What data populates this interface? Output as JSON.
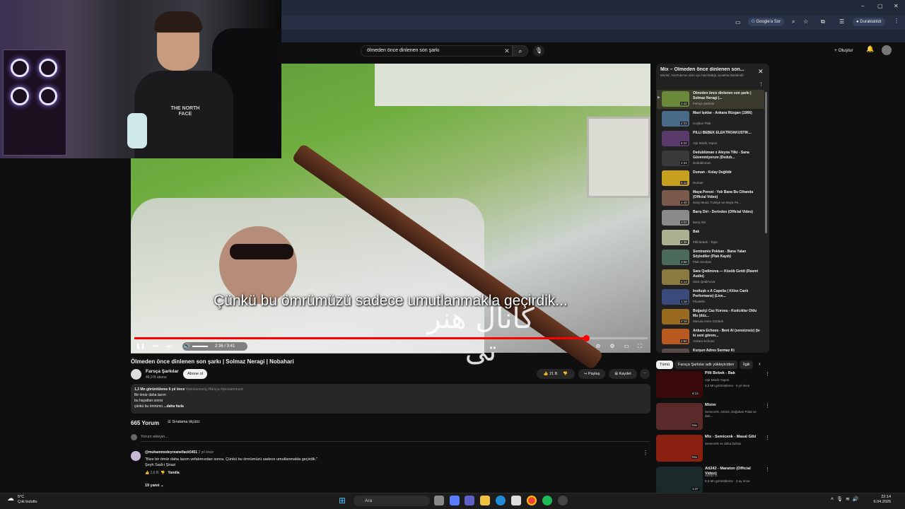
{
  "browser": {
    "search_label": "Google'a Sor",
    "profile_label": "Duraklatıldı",
    "window_controls": [
      "–",
      "▢",
      "✕"
    ]
  },
  "webcam": {
    "shirt_text": "THE NORTH FACE"
  },
  "youtube": {
    "search_value": "ölmeden önce dinlenen son şarkı",
    "create_label": "Oluştur"
  },
  "video": {
    "subtitle": "Çünkü bu ömrümüzü sadece umutlanmakla geçirdik...",
    "watermark": "کانال هنر تی",
    "time": "2:36 / 3:41",
    "progress": 0.88,
    "title": "Ölmeden önce dinlenen son şarkı | Solmaz Neragi | Nobahari"
  },
  "channel": {
    "name": "Farsça Şarkılar",
    "subs": "46,9 B abone",
    "subscribe_label": "Abone ol"
  },
  "actions": {
    "likes": "21 B",
    "share": "Paylaş",
    "save": "Kaydet"
  },
  "description": {
    "meta": "1,3 Mn görüntüleme  6 yıl önce",
    "tags": "#persiansong #farsça #persianmusic",
    "line1": "Bir ömür daha lazım",
    "line2": "bu hayattan sonra",
    "line3": "çünkü bu ömrümü",
    "more": "...daha fazla"
  },
  "comments": {
    "count": "665 Yorum",
    "sort_label": "Sıralama ölçütü:",
    "placeholder": "Yorum ekleyin...",
    "items": [
      {
        "author": "@muhammedeyreanellack5451",
        "time": "2 yıl önce",
        "text1": "\"Bize bir ömür daha lazım vefatımızdan sonra. Çünkü bu ömrümüzü sadece umutlanmakla geçirdik.\"",
        "text2": "Şeyh Sadi-i Şirazi",
        "likes": "1,6 B",
        "reply": "Yanıtla",
        "replies": "19 yanıt"
      }
    ]
  },
  "playlist": {
    "title": "Mix – Ölmeden önce dinlenen son...",
    "subtitle": "Mix'ler, YouTube'un sizin için hazırladığı oynatma listeleridir",
    "items": [
      {
        "title": "Ölmeden önce dinlenen son şarkı | Solmaz Neragi |...",
        "channel": "Farsça Şarkılar",
        "duration": "3:42",
        "color": "#6a8a3a",
        "active": true
      },
      {
        "title": "Mavi Işıklar - Ankara Rüzgarı (1966)",
        "channel": "Coşkun Plak",
        "duration": "2:23",
        "color": "#4a6a8a"
      },
      {
        "title": "PİLLİ BEBEK ELEKTROAKUSTİK...",
        "channel": "Aşk Müzik Yapım",
        "duration": "6:22",
        "color": "#5a3a6a"
      },
      {
        "title": "Dedublüman x Aleyna Tilki - Sana Güvenmiyorum (Dedub...",
        "channel": "Dedublüman",
        "duration": "2:34",
        "color": "#3a3a3a"
      },
      {
        "title": "Duman - Kolay Değildir",
        "channel": "Duman",
        "duration": "5:11",
        "color": "#c8a020"
      },
      {
        "title": "Maya Perest - Yok Bana Bu Cihanda (Official Video)",
        "channel": "Sony Music Türkiye ve Maya Pe...",
        "duration": "4:40",
        "color": "#7a5a4a"
      },
      {
        "title": "Barış Diri - Derinden (Official Video)",
        "channel": "Barış Diri",
        "duration": "3:02",
        "color": "#8a8a8a"
      },
      {
        "title": "Bak",
        "channel": "Pilli Bebek - Topic",
        "duration": "4:36",
        "color": "#aab090"
      },
      {
        "title": "Semiramis Pekkan - Bana Yalan Söylediler (Plak Kaydı)",
        "channel": "Plak Sevdası",
        "duration": "3:58",
        "color": "#4a6a5a"
      },
      {
        "title": "Sara Qədimova — Küsüb Getdi (Rasmi Audio)",
        "channel": "Sara Qedimova",
        "duration": "4:14",
        "color": "#8a7a40"
      },
      {
        "title": "İnstluşk x A Capella ( Kilise Canlı Performans) (Live...",
        "channel": "Pluvtelin",
        "duration": "1:18",
        "color": "#3a4a7a"
      },
      {
        "title": "Boğaziçi Caz Korosu - Kızılcıklar Oldu Mu (düz...",
        "channel": "Mesuia Arem Gözbek",
        "duration": "2:18",
        "color": "#9a6a20"
      },
      {
        "title": "Ankara Echoes - Beni Al (sensiznsiz) (te ki seni görem...",
        "channel": "Ankara Echoes",
        "duration": "2:50",
        "color": "#b85a20"
      },
      {
        "title": "Kurşun Adres Sormaz Ki",
        "channel": "",
        "duration": "",
        "color": "#5a4a4a"
      }
    ]
  },
  "chips": [
    "Tümü",
    "Farsça Şarkılar adlı yükleyiciden",
    "İlgili"
  ],
  "recommendations": [
    {
      "title": "Pilli Bebek - Bak",
      "channel": "Aşk Müzik Yapım",
      "meta": "4,2 Mn görüntüleme · 6 yıl önce",
      "duration": "6:14",
      "color": "#3a0a0a"
    },
    {
      "title": "Mixim",
      "channel": "Semicenk, Ati242, Doğukan Polat ve dah...",
      "meta": "",
      "duration": "Mix",
      "color": "#5a2a2a"
    },
    {
      "title": "Mix - Semicenk - Masal Gibi",
      "channel": "Semicenk ve daha fazlası",
      "meta": "",
      "duration": "Mix",
      "color": "#8a2010"
    },
    {
      "title": "Ati242 - Maraton (Official Video)",
      "channel": "Ati242 ⊙",
      "meta": "8,5 Mn görüntüleme · 3 ay önce",
      "duration": "3:37",
      "color": "#1a2a2a"
    }
  ],
  "taskbar": {
    "weather_temp": "5°C",
    "weather_desc": "Çok bulutlu",
    "search_placeholder": "Ara",
    "time": "22:14",
    "date": "6.04.2026"
  }
}
